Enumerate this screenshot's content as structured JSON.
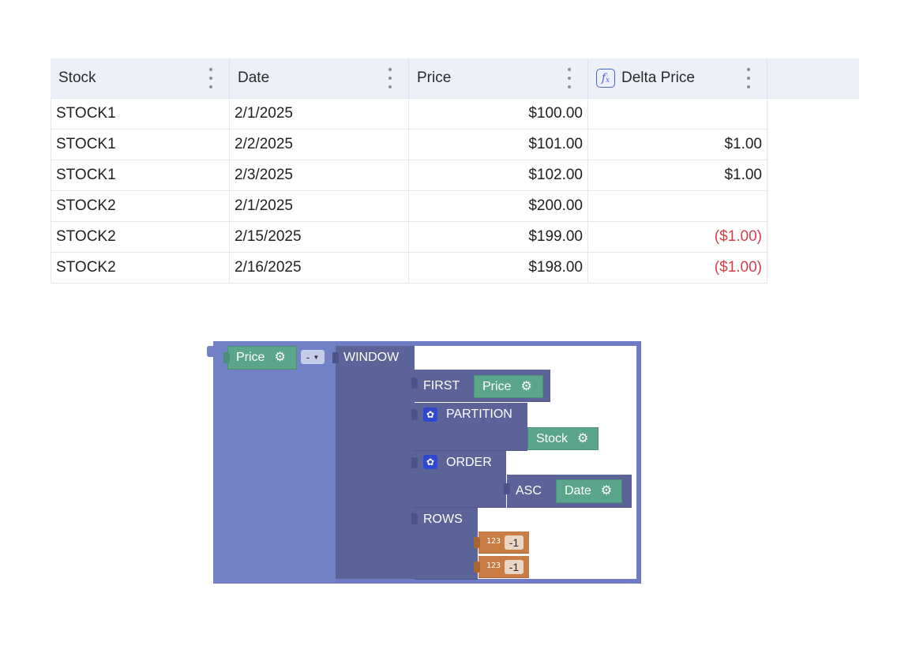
{
  "table": {
    "headers": [
      "Stock",
      "Date",
      "Price",
      "Delta Price"
    ],
    "formula_icon": "fx-icon",
    "rows": [
      [
        "STOCK1",
        "2/1/2025",
        "$100.00",
        ""
      ],
      [
        "STOCK1",
        "2/2/2025",
        "$101.00",
        "$1.00"
      ],
      [
        "STOCK1",
        "2/3/2025",
        "$102.00",
        "$1.00"
      ],
      [
        "STOCK2",
        "2/1/2025",
        "$200.00",
        ""
      ],
      [
        "STOCK2",
        "2/15/2025",
        "$199.00",
        "($1.00)"
      ],
      [
        "STOCK2",
        "2/16/2025",
        "$198.00",
        "($1.00)"
      ]
    ],
    "negative_color": "#d6404b"
  },
  "blocks": {
    "price_field": "Price",
    "operator": "-",
    "window_label": "WINDOW",
    "first_label": "FIRST",
    "first_field": "Price",
    "partition_label": "PARTITION",
    "partition_field": "Stock",
    "order_label": "ORDER",
    "asc_label": "ASC",
    "order_field": "Date",
    "rows_label": "ROWS",
    "num_icon_label": "123",
    "rows_from": "-1",
    "rows_to": "-1"
  }
}
